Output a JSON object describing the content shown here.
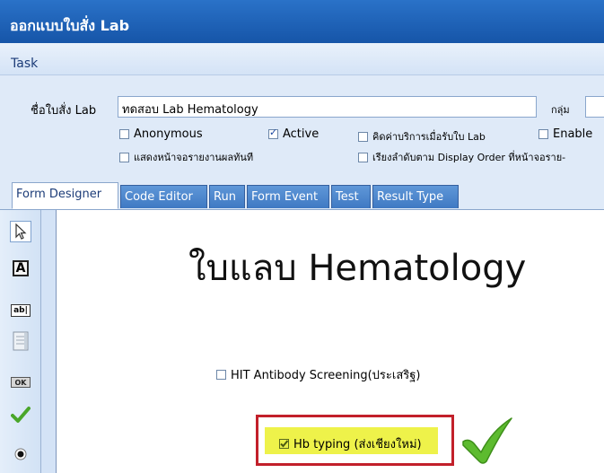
{
  "window": {
    "title": "ออกแบบใบสั่ง Lab"
  },
  "menu": {
    "task": "Task"
  },
  "props": {
    "name_label": "ชื่อใบสั่ง Lab",
    "name_value": "ทดสอบ Lab Hematology",
    "group_label": "กลุ่ม",
    "group_value": "",
    "anonymous": {
      "label": "Anonymous",
      "checked": false
    },
    "active": {
      "label": "Active",
      "checked": true
    },
    "charge_on_receive": {
      "label": "คิดค่าบริการเมื่อรับใบ Lab",
      "checked": false
    },
    "enable": {
      "label": "Enable",
      "checked": false
    },
    "show_report": {
      "label": "แสดงหน้าจอรายงานผลทันที",
      "checked": false
    },
    "sort_display": {
      "label": "เรียงลำดับตาม Display Order ที่หน้าจอราย-",
      "checked": false
    }
  },
  "tabs": [
    {
      "label": "Form Designer",
      "active": true
    },
    {
      "label": "Code Editor",
      "active": false
    },
    {
      "label": "Run",
      "active": false
    },
    {
      "label": "Form Event",
      "active": false
    },
    {
      "label": "Test",
      "active": false
    },
    {
      "label": "Result Type",
      "active": false
    }
  ],
  "tools": {
    "pointer": "pointer-icon",
    "label": "label-tool-icon",
    "textbox": "textbox-tool-icon",
    "memo": "memo-tool-icon",
    "button": "button-tool-icon",
    "checkbox": "checkbox-tool-icon",
    "radio": "radio-tool-icon",
    "button_text": "OK",
    "label_text": "A",
    "textbox_text": "ab|"
  },
  "canvas": {
    "title": "ใบแลบ Hematology",
    "hit_antibody": {
      "label": "HIT Antibody Screening(ประเสริฐ)",
      "checked": false
    },
    "hb_typing": {
      "label": "Hb typing (ส่งเชียงใหม่)",
      "checked": true
    }
  },
  "colors": {
    "title_bar": "#1a5fb4",
    "highlight_frame": "#c2202a",
    "highlight_fill": "#eef24a",
    "big_check": "#4caf2a"
  }
}
